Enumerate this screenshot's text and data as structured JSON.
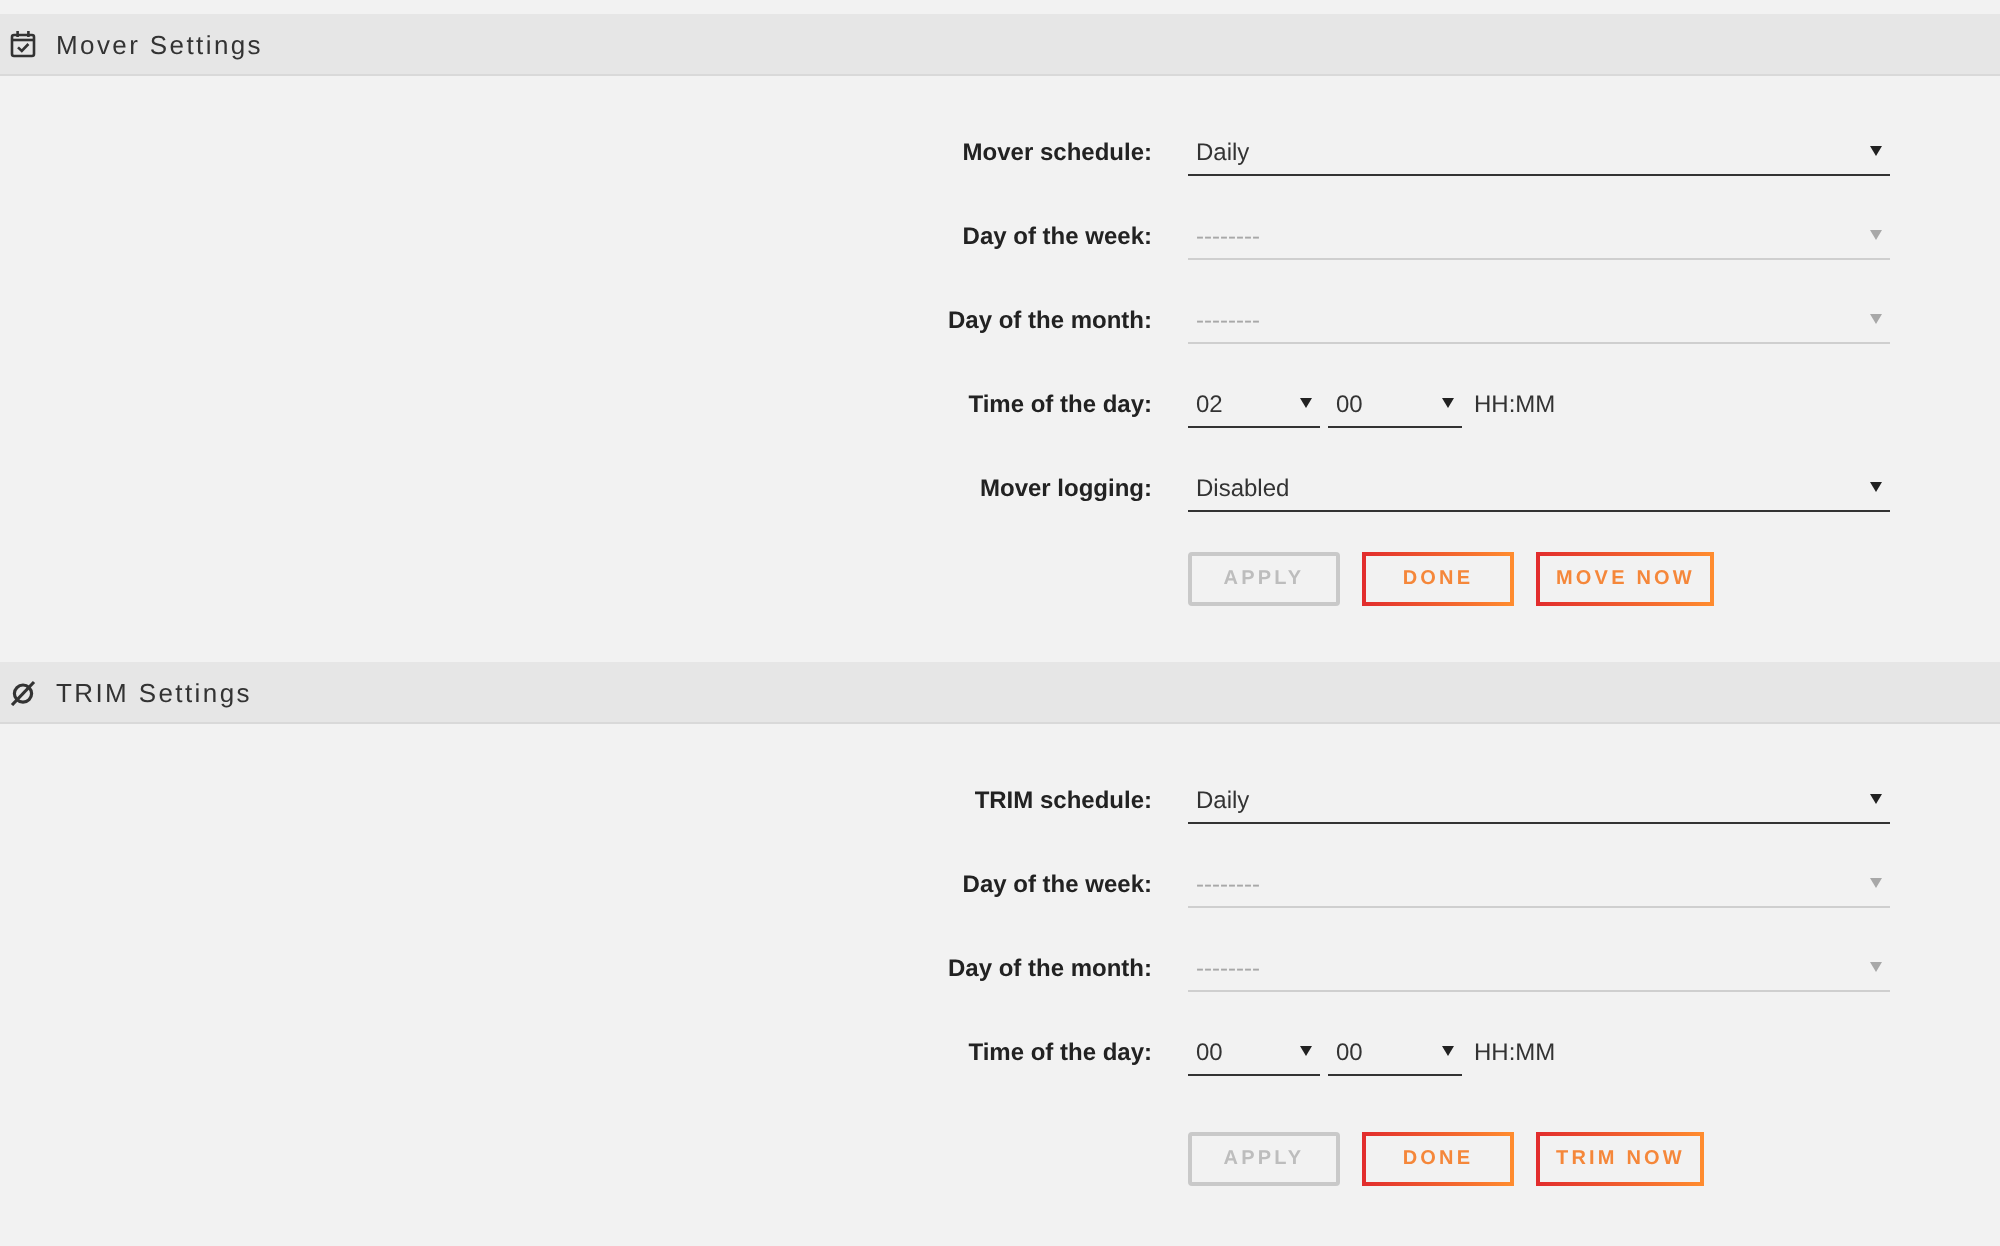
{
  "sections": [
    {
      "title": "Mover Settings",
      "fields": [
        {
          "kind": "select",
          "label": "Mover schedule:",
          "value": "Daily",
          "disabled": false
        },
        {
          "kind": "select",
          "label": "Day of the week:",
          "value": "--------",
          "disabled": true
        },
        {
          "kind": "select",
          "label": "Day of the month:",
          "value": "--------",
          "disabled": true
        },
        {
          "kind": "time",
          "label": "Time of the day:",
          "hour": "02",
          "minute": "00",
          "format": "HH:MM"
        },
        {
          "kind": "select",
          "label": "Mover logging:",
          "value": "Disabled",
          "disabled": false
        }
      ],
      "buttons": [
        {
          "label": "APPLY",
          "disabled": true
        },
        {
          "label": "DONE",
          "disabled": false
        },
        {
          "label": "MOVE NOW",
          "disabled": false
        }
      ]
    },
    {
      "title": "TRIM Settings",
      "fields": [
        {
          "kind": "select",
          "label": "TRIM schedule:",
          "value": "Daily",
          "disabled": false
        },
        {
          "kind": "select",
          "label": "Day of the week:",
          "value": "--------",
          "disabled": true
        },
        {
          "kind": "select",
          "label": "Day of the month:",
          "value": "--------",
          "disabled": true
        },
        {
          "kind": "time",
          "label": "Time of the day:",
          "hour": "00",
          "minute": "00",
          "format": "HH:MM"
        }
      ],
      "buttons": [
        {
          "label": "APPLY",
          "disabled": true
        },
        {
          "label": "DONE",
          "disabled": false
        },
        {
          "label": "TRIM NOW",
          "disabled": false
        }
      ]
    }
  ]
}
